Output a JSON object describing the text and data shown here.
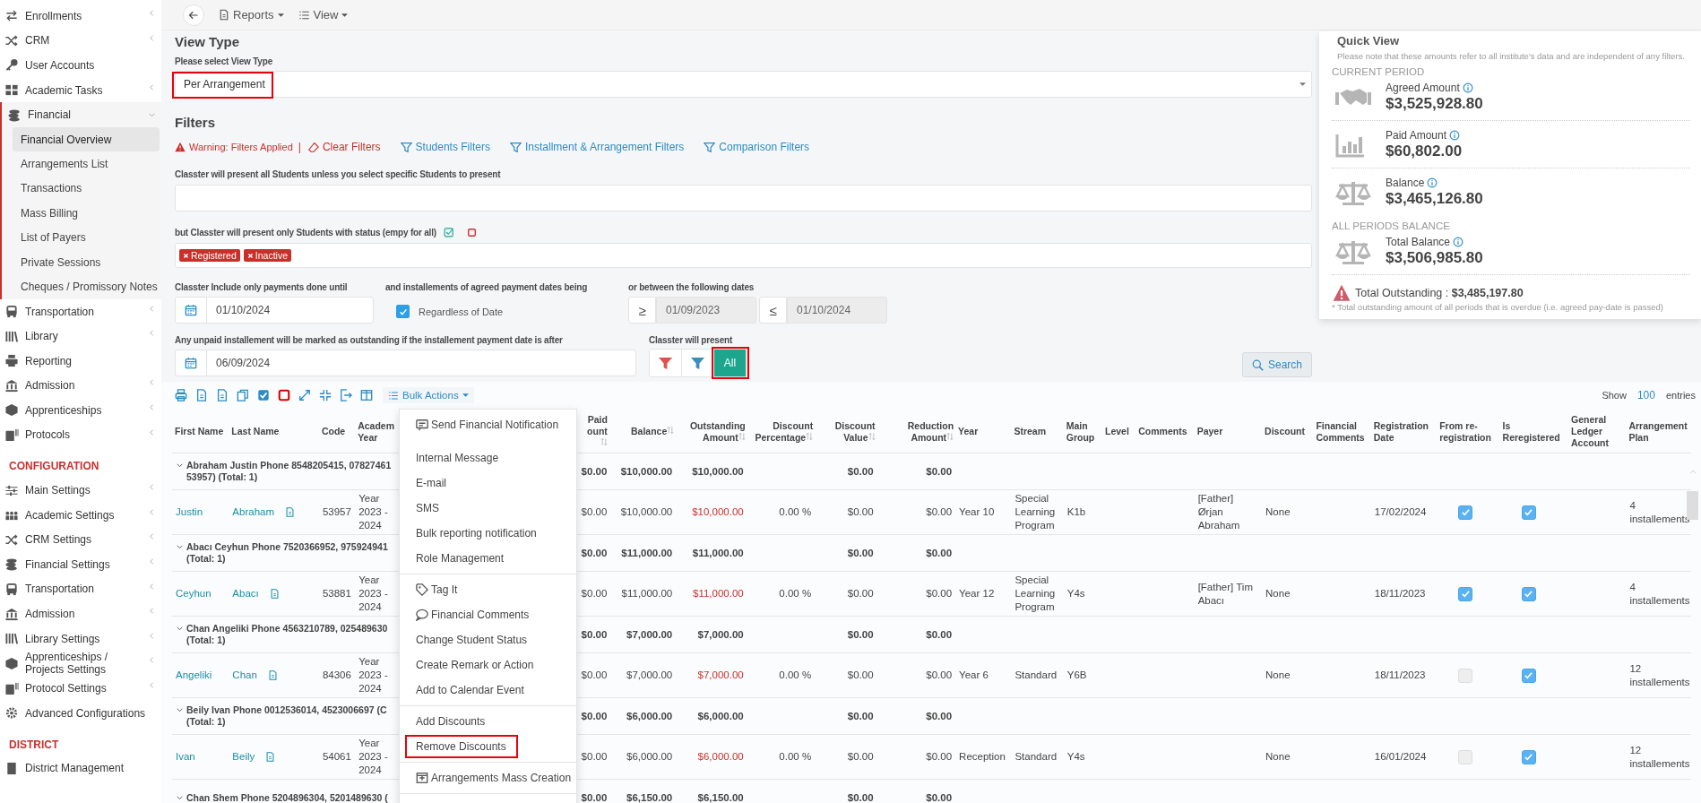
{
  "sidebar": {
    "items": [
      {
        "kind": "item",
        "label": "Enrollments",
        "expanded": false,
        "selected": false
      },
      {
        "kind": "item",
        "label": "CRM",
        "expanded": false,
        "selected": false
      },
      {
        "kind": "item",
        "label": "User Accounts",
        "selected": false
      },
      {
        "kind": "item",
        "label": "Academic Tasks",
        "expanded": false,
        "selected": false
      },
      {
        "kind": "item",
        "label": "Financial",
        "expanded": true,
        "selected": false,
        "children": [
          {
            "label": "Financial Overview",
            "selected": true
          },
          {
            "label": "Arrangements List",
            "selected": false
          },
          {
            "label": "Transactions",
            "selected": false
          },
          {
            "label": "Mass Billing",
            "selected": false
          },
          {
            "label": "List of Payers",
            "selected": false
          },
          {
            "label": "Private Sessions",
            "selected": false
          },
          {
            "label": "Cheques / Promissory Notes",
            "selected": false
          }
        ]
      },
      {
        "kind": "item",
        "label": "Transportation",
        "expanded": false,
        "selected": false
      },
      {
        "kind": "item",
        "label": "Library",
        "expanded": false,
        "selected": false
      },
      {
        "kind": "item",
        "label": "Reporting",
        "selected": false
      },
      {
        "kind": "item",
        "label": "Admission",
        "expanded": false,
        "selected": false
      },
      {
        "kind": "item",
        "label": "Apprenticeships",
        "expanded": false,
        "selected": false
      },
      {
        "kind": "item",
        "label": "Protocols",
        "expanded": false,
        "selected": false
      },
      {
        "kind": "header",
        "label": "CONFIGURATION"
      },
      {
        "kind": "item",
        "label": "Main Settings",
        "expanded": false,
        "selected": false
      },
      {
        "kind": "item",
        "label": "Academic Settings",
        "expanded": false,
        "selected": false
      },
      {
        "kind": "item",
        "label": "CRM Settings",
        "expanded": false,
        "selected": false
      },
      {
        "kind": "item",
        "label": "Financial Settings",
        "expanded": false,
        "selected": false
      },
      {
        "kind": "item",
        "label": "Transportation",
        "expanded": false,
        "selected": false
      },
      {
        "kind": "item",
        "label": "Admission",
        "expanded": false,
        "selected": false
      },
      {
        "kind": "item",
        "label": "Library Settings",
        "expanded": false,
        "selected": false
      },
      {
        "kind": "item",
        "label": "Apprenticeships / Projects Settings",
        "expanded": false,
        "selected": false
      },
      {
        "kind": "item",
        "label": "Protocol Settings",
        "expanded": false,
        "selected": false
      },
      {
        "kind": "item",
        "label": "Advanced Configurations",
        "selected": false
      },
      {
        "kind": "header",
        "label": "DISTRICT"
      },
      {
        "kind": "item",
        "label": "District Management",
        "selected": false
      }
    ]
  },
  "topbar": {
    "reports": "Reports",
    "view": "View"
  },
  "view_type": {
    "heading": "View Type",
    "label": "Please select View Type",
    "value": "Per Arrangement",
    "highlighted": true
  },
  "filters": {
    "heading": "Filters",
    "warning": "Warning: Filters Applied",
    "separator": "|",
    "clear": "Clear Filters",
    "links": [
      "Students Filters",
      "Installment & Arrangement Filters",
      "Comparison Filters"
    ],
    "students_label": "Classter will present all Students unless you select specific Students to present",
    "status_label": "but Classter will present only Students with status (empy for all)",
    "status_tags": [
      "Registered",
      "Inactive"
    ],
    "payments_label": "Classter Include only payments done until",
    "payments_date": "01/10/2024",
    "agreed_label": "and installements of agreed payment dates being",
    "regardless": {
      "label": "Regardless of Date",
      "checked": true
    },
    "between_label": "or between the following dates",
    "from": {
      "sign": "≥",
      "value": "01/09/2023",
      "disabled": true
    },
    "to": {
      "sign": "≤",
      "value": "01/10/2024",
      "disabled": true
    },
    "outstanding_label": "Any unpaid installement will be marked as outstanding if the installement payment date is after",
    "outstanding_date": "06/09/2024",
    "present_label": "Classter will present",
    "present_options": [
      {
        "kind": "icon",
        "color": "#d9534f",
        "selected": false
      },
      {
        "kind": "icon",
        "color": "#3c8dbc",
        "selected": false
      },
      {
        "kind": "text",
        "label": "All",
        "selected": true,
        "highlighted": true
      }
    ],
    "search": "Search"
  },
  "quick_view": {
    "title": "Quick View",
    "note": "Please note that these amounts refer to all institute's data and are independent of any filters.",
    "sections": [
      {
        "heading": "CURRENT PERIOD",
        "stats": [
          {
            "label": "Agreed Amount",
            "value": "$3,525,928.80"
          },
          {
            "label": "Paid Amount",
            "value": "$60,802.00"
          },
          {
            "label": "Balance",
            "value": "$3,465,126.80"
          }
        ]
      },
      {
        "heading": "ALL PERIODS BALANCE",
        "stats": [
          {
            "label": "Total Balance",
            "value": "$3,506,985.80"
          }
        ]
      }
    ],
    "outstanding": "Total Outstanding : **$3,485,197.80**",
    "outstanding_note": "* Total outstanding amount of all periods that is overdue (i.e. agreed pay-date is passed)"
  },
  "table": {
    "bulk_actions": "Bulk Actions",
    "show_label": "Show",
    "show_count": "100",
    "entries_label": "entries",
    "columns": [
      {
        "label": "First Name",
        "sortable": false
      },
      {
        "label": "Last Name",
        "sortable": false
      },
      {
        "label": "Code",
        "sortable": false
      },
      {
        "label": "Academ Year",
        "sortable": false
      },
      {
        "label": "Paid ount",
        "sortable": true
      },
      {
        "label": "Balance",
        "sortable": true
      },
      {
        "label": "Outstanding Amount",
        "sortable": true
      },
      {
        "label": "Discount Percentage",
        "sortable": true
      },
      {
        "label": "Discount Value",
        "sortable": true
      },
      {
        "label": "Reduction Amount",
        "sortable": true
      },
      {
        "label": "Year",
        "sortable": false
      },
      {
        "label": "Stream",
        "sortable": false
      },
      {
        "label": "Main Group",
        "sortable": false
      },
      {
        "label": "Level",
        "sortable": false
      },
      {
        "label": "Comments",
        "sortable": false
      },
      {
        "label": "Payer",
        "sortable": false
      },
      {
        "label": "Discount",
        "sortable": false
      },
      {
        "label": "Financial Comments",
        "sortable": false
      },
      {
        "label": "Registration Date",
        "sortable": false
      },
      {
        "label": "From re-registration",
        "sortable": false
      },
      {
        "label": "Is Reregistered",
        "sortable": false
      },
      {
        "label": "General Ledger Account",
        "sortable": false
      },
      {
        "label": "Arrangement Plan",
        "sortable": false
      }
    ],
    "groups": [
      {
        "label": "Abraham Justin Phone 8548205415, 07827461 53957) (Total: 1)",
        "expanded": true,
        "paid": "$0.00",
        "balance": "$10,000.00",
        "outstanding": "$10,000.00",
        "discount_value": "$0.00",
        "reduction": "$0.00",
        "rows": [
          {
            "first_name": "Justin",
            "last_name": "Abraham",
            "code": "53957",
            "academic_year": "Year 2023 - 2024",
            "paid": "$0.00",
            "balance": "$10,000.00",
            "outstanding": "$10,000.00",
            "discount_percentage": "0.00 %",
            "discount_value": "$0.00",
            "reduction": "$0.00",
            "year": "Year 10",
            "stream": "Special Learning Program",
            "main_group": "K1b",
            "payer": "[Father] Ørjan Abraham",
            "discount": "None",
            "registration_date": "17/02/2024",
            "from_reregistration": true,
            "is_reregistered": true,
            "arrangement_plan": "4 installements"
          }
        ]
      },
      {
        "label": "Abacı Ceyhun Phone 7520366952, 975924941 (Total: 1)",
        "expanded": true,
        "paid": "$0.00",
        "balance": "$11,000.00",
        "outstanding": "$11,000.00",
        "discount_value": "$0.00",
        "reduction": "$0.00",
        "rows": [
          {
            "first_name": "Ceyhun",
            "last_name": "Abacı",
            "code": "53881",
            "academic_year": "Year 2023 - 2024",
            "paid": "$0.00",
            "balance": "$11,000.00",
            "outstanding": "$11,000.00",
            "discount_percentage": "0.00 %",
            "discount_value": "$0.00",
            "reduction": "$0.00",
            "year": "Year 12",
            "stream": "Special Learning Program",
            "main_group": "Y4s",
            "payer": "[Father] Tim Abacı",
            "discount": "None",
            "registration_date": "18/11/2023",
            "from_reregistration": true,
            "is_reregistered": true,
            "arrangement_plan": "4 installements"
          }
        ]
      },
      {
        "label": "Chan Angeliki Phone 4563210789, 025489630 (Total: 1)",
        "expanded": true,
        "paid": "$0.00",
        "balance": "$7,000.00",
        "outstanding": "$7,000.00",
        "discount_value": "$0.00",
        "reduction": "$0.00",
        "rows": [
          {
            "first_name": "Angeliki",
            "last_name": "Chan",
            "code": "84306",
            "academic_year": "Year 2023 - 2024",
            "paid": "$0.00",
            "balance": "$7,000.00",
            "outstanding": "$7,000.00",
            "discount_percentage": "0.00 %",
            "discount_value": "$0.00",
            "reduction": "$0.00",
            "year": "Year 6",
            "stream": "Standard",
            "main_group": "Y6B",
            "discount": "None",
            "registration_date": "18/11/2023",
            "from_reregistration": false,
            "is_reregistered": true,
            "arrangement_plan": "12 installements"
          }
        ]
      },
      {
        "label": "Beily Ivan Phone 0012536014, 4523006697 (C (Total: 1)",
        "expanded": true,
        "paid": "$0.00",
        "balance": "$6,000.00",
        "outstanding": "$6,000.00",
        "discount_value": "$0.00",
        "reduction": "$0.00",
        "rows": [
          {
            "first_name": "Ivan",
            "last_name": "Beily",
            "code": "54061",
            "academic_year": "Year 2023 - 2024",
            "paid": "$0.00",
            "balance": "$6,000.00",
            "outstanding": "$6,000.00",
            "discount_percentage": "0.00 %",
            "discount_value": "$0.00",
            "reduction": "$0.00",
            "year": "Reception",
            "stream": "Standard",
            "main_group": "Y4s",
            "discount": "None",
            "registration_date": "16/01/2024",
            "from_reregistration": false,
            "is_reregistered": true,
            "arrangement_plan": "12 installements"
          }
        ]
      },
      {
        "label": "Chan Shem Phone 5204896304, 5201489630 (",
        "expanded": true,
        "paid": "$0.00",
        "balance": "$6,150.00",
        "outstanding": "$6,150.00",
        "discount_value": "$0.00",
        "reduction": "$0.00"
      }
    ]
  },
  "bulk_menu": {
    "groups": [
      {
        "items": [
          {
            "kind": "notify",
            "label": "Send Financial Notification"
          },
          {
            "kind": "plain",
            "label": "Internal Message"
          },
          {
            "kind": "plain",
            "label": "E-mail"
          },
          {
            "kind": "plain",
            "label": "SMS"
          },
          {
            "kind": "plain",
            "label": "Bulk reporting notification"
          },
          {
            "kind": "plain",
            "label": "Role Management"
          }
        ]
      },
      {
        "items": [
          {
            "kind": "tag",
            "label": "Tag It"
          },
          {
            "kind": "comment",
            "label": "Financial Comments"
          },
          {
            "kind": "plain",
            "label": "Change Student Status"
          },
          {
            "kind": "plain",
            "label": "Create Remark or Action"
          },
          {
            "kind": "plain",
            "label": "Add to Calendar Event"
          }
        ]
      },
      {
        "items": [
          {
            "kind": "plain",
            "label": "Add Discounts"
          },
          {
            "kind": "plain",
            "label": "Remove Discounts",
            "highlighted": true
          }
        ]
      },
      {
        "items": [
          {
            "kind": "create",
            "label": "Arrangements Mass Creation"
          }
        ]
      }
    ]
  }
}
